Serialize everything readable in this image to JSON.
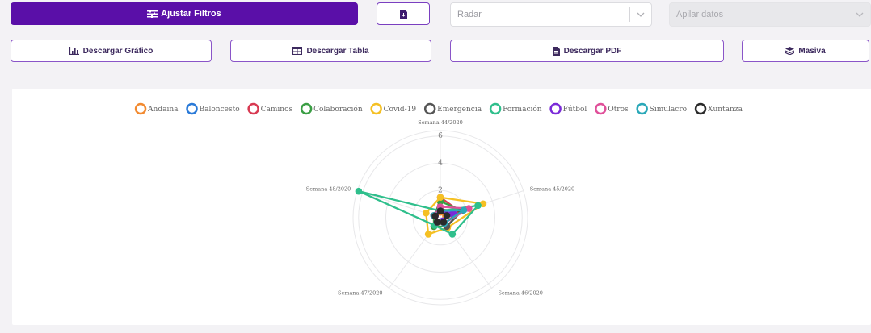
{
  "toolbar": {
    "adjust_filters_label": "Ajustar Filtros",
    "chart_type_value": "Radar",
    "stack_placeholder": "Apilar datos",
    "download_chart_label": "Descargar Gráfico",
    "download_table_label": "Descargar Tabla",
    "download_pdf_label": "Descargar PDF",
    "bulk_label": "Masiva",
    "accent_color": "#5a0fa8"
  },
  "chart_data": {
    "type": "radar",
    "axes": [
      "Semana 44/2020",
      "Semana 45/2020",
      "Semana 46/2020",
      "Semana 47/2020",
      "Semana 48/2020"
    ],
    "ticks": [
      2,
      4,
      6
    ],
    "rmax": 6.4,
    "grid": true,
    "legend_position": "top",
    "series": [
      {
        "name": "Andaina",
        "color": "#f28a30",
        "values": [
          0.4,
          0.4,
          0.4,
          0.8,
          0.5
        ]
      },
      {
        "name": "Baloncesto",
        "color": "#2a7ad8",
        "values": [
          0.5,
          0.9,
          0.3,
          0.4,
          0.4
        ]
      },
      {
        "name": "Caminos",
        "color": "#d83a52",
        "values": [
          1.5,
          1.5,
          0.5,
          0.4,
          0.4
        ]
      },
      {
        "name": "Colaboración",
        "color": "#3a9e44",
        "values": [
          1.2,
          1.7,
          0.8,
          0.8,
          0.5
        ]
      },
      {
        "name": "Covid-19",
        "color": "#f5c023",
        "values": [
          1.5,
          3.3,
          0.9,
          1.5,
          1.1
        ]
      },
      {
        "name": "Emergencia",
        "color": "#555555",
        "values": [
          0.6,
          1.6,
          0.8,
          0.4,
          0.5
        ]
      },
      {
        "name": "Formación",
        "color": "#2fbf8c",
        "values": [
          0.5,
          2.9,
          1.5,
          0.7,
          6.3
        ]
      },
      {
        "name": "Fútbol",
        "color": "#7a2ad8",
        "values": [
          0.5,
          1.0,
          0.3,
          0.4,
          0.4
        ]
      },
      {
        "name": "Otros",
        "color": "#e0509a",
        "values": [
          0.8,
          2.2,
          0.5,
          0.4,
          0.5
        ]
      },
      {
        "name": "Simulacro",
        "color": "#2aa8b8",
        "values": [
          0.5,
          1.8,
          0.5,
          0.4,
          0.5
        ]
      },
      {
        "name": "Xuntanza",
        "color": "#2a2a2a",
        "values": [
          0.5,
          0.5,
          0.4,
          0.4,
          0.4
        ]
      }
    ]
  }
}
